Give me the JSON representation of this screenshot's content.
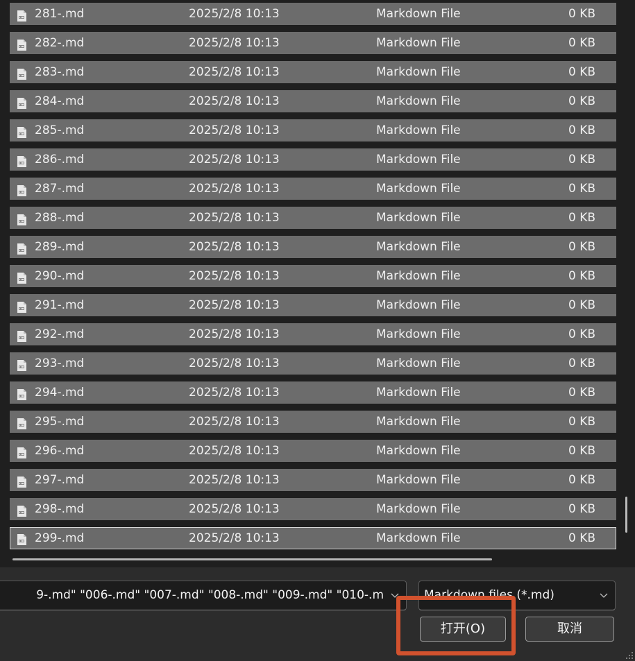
{
  "file_list": {
    "rows": [
      {
        "name": "281-.md",
        "date": "2025/2/8 10:13",
        "type": "Markdown File",
        "size": "0 KB"
      },
      {
        "name": "282-.md",
        "date": "2025/2/8 10:13",
        "type": "Markdown File",
        "size": "0 KB"
      },
      {
        "name": "283-.md",
        "date": "2025/2/8 10:13",
        "type": "Markdown File",
        "size": "0 KB"
      },
      {
        "name": "284-.md",
        "date": "2025/2/8 10:13",
        "type": "Markdown File",
        "size": "0 KB"
      },
      {
        "name": "285-.md",
        "date": "2025/2/8 10:13",
        "type": "Markdown File",
        "size": "0 KB"
      },
      {
        "name": "286-.md",
        "date": "2025/2/8 10:13",
        "type": "Markdown File",
        "size": "0 KB"
      },
      {
        "name": "287-.md",
        "date": "2025/2/8 10:13",
        "type": "Markdown File",
        "size": "0 KB"
      },
      {
        "name": "288-.md",
        "date": "2025/2/8 10:13",
        "type": "Markdown File",
        "size": "0 KB"
      },
      {
        "name": "289-.md",
        "date": "2025/2/8 10:13",
        "type": "Markdown File",
        "size": "0 KB"
      },
      {
        "name": "290-.md",
        "date": "2025/2/8 10:13",
        "type": "Markdown File",
        "size": "0 KB"
      },
      {
        "name": "291-.md",
        "date": "2025/2/8 10:13",
        "type": "Markdown File",
        "size": "0 KB"
      },
      {
        "name": "292-.md",
        "date": "2025/2/8 10:13",
        "type": "Markdown File",
        "size": "0 KB"
      },
      {
        "name": "293-.md",
        "date": "2025/2/8 10:13",
        "type": "Markdown File",
        "size": "0 KB"
      },
      {
        "name": "294-.md",
        "date": "2025/2/8 10:13",
        "type": "Markdown File",
        "size": "0 KB"
      },
      {
        "name": "295-.md",
        "date": "2025/2/8 10:13",
        "type": "Markdown File",
        "size": "0 KB"
      },
      {
        "name": "296-.md",
        "date": "2025/2/8 10:13",
        "type": "Markdown File",
        "size": "0 KB"
      },
      {
        "name": "297-.md",
        "date": "2025/2/8 10:13",
        "type": "Markdown File",
        "size": "0 KB"
      },
      {
        "name": "298-.md",
        "date": "2025/2/8 10:13",
        "type": "Markdown File",
        "size": "0 KB"
      },
      {
        "name": "299-.md",
        "date": "2025/2/8 10:13",
        "type": "Markdown File",
        "size": "0 KB"
      }
    ],
    "focused_row": "299-.md",
    "icon": "markdown-file-icon"
  },
  "footer": {
    "filename_value": "9-.md\" \"006-.md\" \"007-.md\" \"008-.md\" \"009-.md\" \"010-.m",
    "filetype_selected": "Markdown files (*.md)",
    "open_label": "打开(O)",
    "cancel_label": "取消"
  },
  "colors": {
    "row_background": "#6c6c6c",
    "highlight_border": "#d2522e"
  }
}
